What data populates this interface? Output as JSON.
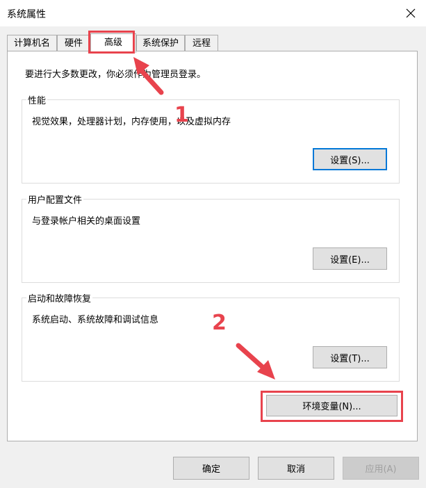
{
  "window": {
    "title": "系统属性"
  },
  "tabs": [
    {
      "label": "计算机名"
    },
    {
      "label": "硬件"
    },
    {
      "label": "高级"
    },
    {
      "label": "系统保护"
    },
    {
      "label": "远程"
    }
  ],
  "notice": "要进行大多数更改，你必须作为管理员登录。",
  "groups": {
    "performance": {
      "title": "性能",
      "desc": "视觉效果，处理器计划，内存使用，以及虚拟内存",
      "button": "设置(S)..."
    },
    "profile": {
      "title": "用户配置文件",
      "desc": "与登录帐户相关的桌面设置",
      "button": "设置(E)..."
    },
    "startup": {
      "title": "启动和故障恢复",
      "desc": "系统启动、系统故障和调试信息",
      "button": "设置(T)..."
    }
  },
  "env_button": "环境变量(N)...",
  "footer": {
    "ok": "确定",
    "cancel": "取消",
    "apply": "应用(A)"
  },
  "annotations": {
    "step1": "1",
    "step2": "2",
    "color": "#e8434d"
  }
}
